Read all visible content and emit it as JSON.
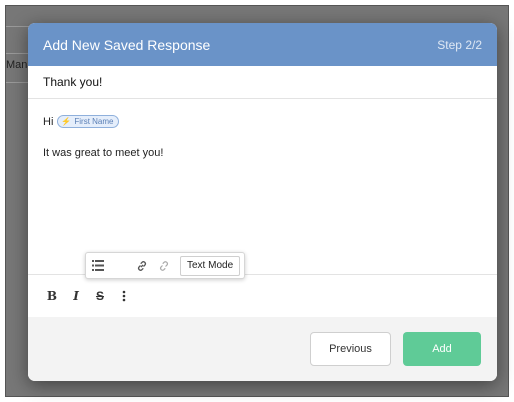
{
  "background": {
    "partial_text": "Mana"
  },
  "modal": {
    "title": "Add New Saved Response",
    "step": "Step 2/2",
    "subject": "Thank you!",
    "body": {
      "greeting": "Hi",
      "token_label": "First Name",
      "token_icon": "lightning-icon",
      "line2": "It was great to meet you!"
    },
    "floating_toolbar": {
      "list_icon": "list-icon",
      "link_icon": "link-icon",
      "unlink_icon": "unlink-icon",
      "text_mode_label": "Text Mode"
    },
    "format_toolbar": {
      "bold_icon": "bold-icon",
      "italic_icon": "italic-icon",
      "strike_icon": "strikethrough-icon",
      "more_icon": "more-vertical-icon"
    },
    "footer": {
      "previous_label": "Previous",
      "add_label": "Add"
    }
  },
  "colors": {
    "header": "#6a93c8",
    "add_button": "#5fcb97",
    "token_bg": "#e5eefb"
  }
}
